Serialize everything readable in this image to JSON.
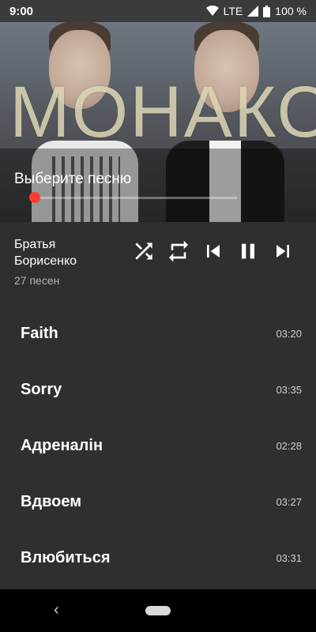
{
  "status_bar": {
    "time": "9:00",
    "network": "LTE",
    "battery": "100 %"
  },
  "cover": {
    "logo_text": "МОНАКО",
    "now_playing_label": "Выберите песню"
  },
  "player": {
    "artist": "Братья Борисенко",
    "song_count": "27 песен",
    "controls": [
      "shuffle-icon",
      "repeat-icon",
      "skip-previous-icon",
      "pause-icon",
      "skip-next-icon"
    ]
  },
  "tracks": [
    {
      "title": "Faith",
      "duration": "03:20"
    },
    {
      "title": "Sorry",
      "duration": "03:35"
    },
    {
      "title": "Адреналін",
      "duration": "02:28"
    },
    {
      "title": "Вдвоем",
      "duration": "03:27"
    },
    {
      "title": "Влюбиться",
      "duration": "03:31"
    }
  ],
  "colors": {
    "accent": "#ff3b30",
    "panel": "#2f2f2f"
  }
}
